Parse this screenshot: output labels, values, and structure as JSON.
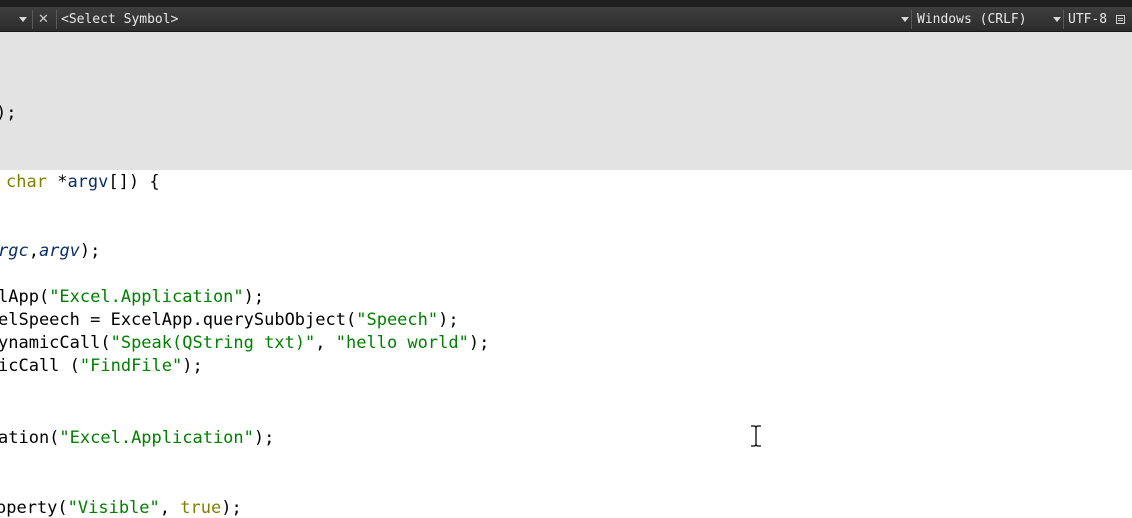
{
  "toolbar": {
    "symbol_selector": "<Select Symbol>",
    "line_ending": "Windows (CRLF)",
    "encoding": "UTF-8"
  },
  "editor": {
    "l1_text": ");",
    "l2_kw": "char",
    "l2_ptr": " *",
    "l2_var": "argv",
    "l2_rest": "[]) {",
    "l3_it1": "rgc",
    "l3_comma": ",",
    "l3_it2": "argv",
    "l3_end": ");",
    "l4_pre": "lApp(",
    "l4_str": "\"Excel.Application\"",
    "l4_end": ");",
    "l5_pre": "elSpeech = ExcelApp.querySubObject(",
    "l5_str": "\"Speech\"",
    "l5_end": ");",
    "l6_pre": "ynamicCall(",
    "l6_str1": "\"Speak(QString txt)\"",
    "l6_mid": ", ",
    "l6_str2": "\"hello world\"",
    "l6_end": ");",
    "l7_pre": "icCall (",
    "l7_str": "\"FindFile\"",
    "l7_end": ");",
    "l8_pre": "ation(",
    "l8_str": "\"Excel.Application\"",
    "l8_end": ");",
    "l9_pre": "operty(",
    "l9_str": "\"Visible\"",
    "l9_mid": ", ",
    "l9_kw": "true",
    "l9_end": ");"
  }
}
